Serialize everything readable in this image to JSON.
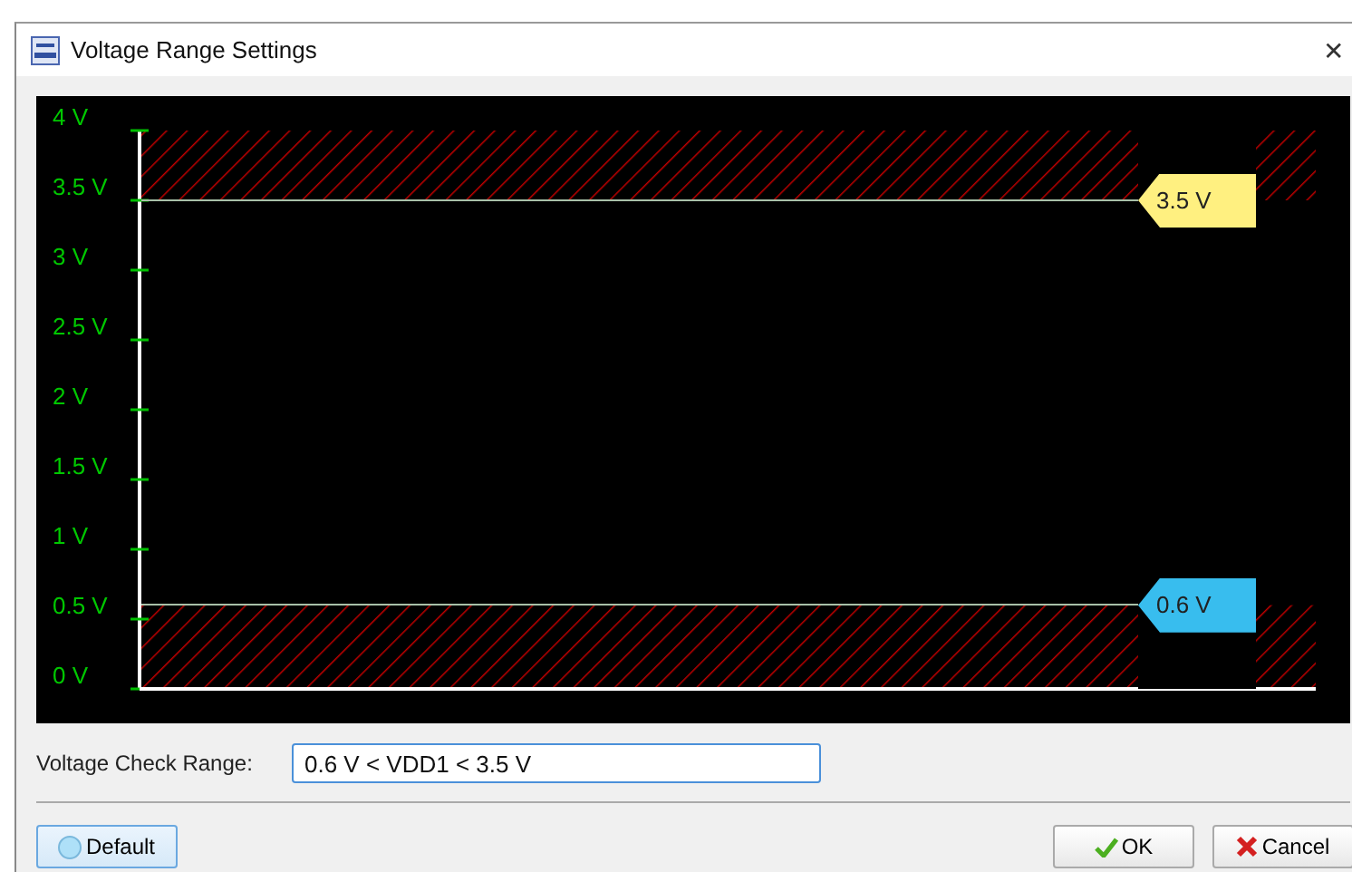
{
  "window": {
    "title": "Voltage Range Settings",
    "close": "✕"
  },
  "range_chart": {
    "ticks": [
      "4 V",
      "3.5 V",
      "3 V",
      "2.5 V",
      "2 V",
      "1.5 V",
      "1 V",
      "0.5 V",
      "0 V"
    ],
    "handles": [
      {
        "label": "3.5 V",
        "level": 0.875,
        "color": "#fff080",
        "kind": "upper"
      },
      {
        "label": "0.6 V",
        "level": 0.15,
        "color": "#38bdee",
        "kind": "lower"
      }
    ]
  },
  "voltage_check_range": {
    "label": "Voltage Check Range:",
    "value": "0.6 V < VDD1 < 3.5 V"
  },
  "buttons": [
    {
      "label": "Default",
      "kind": "default"
    },
    {
      "label": "OK",
      "kind": "ok"
    },
    {
      "label": "Cancel",
      "kind": "cancel"
    }
  ]
}
